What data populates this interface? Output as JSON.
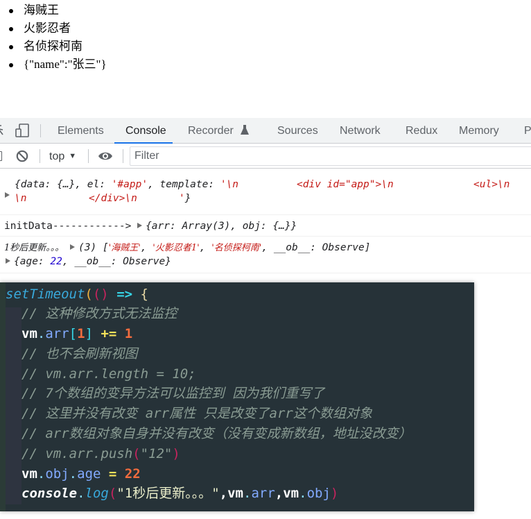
{
  "page": {
    "list_items": [
      "海贼王",
      "火影忍者",
      "名侦探柯南",
      "{\"name\":\"张三\"}"
    ]
  },
  "devtools": {
    "tabs": [
      "Elements",
      "Console",
      "Recorder",
      "Sources",
      "Network",
      "Redux",
      "Memory",
      "Pe"
    ],
    "active_tab": "Console",
    "recorder_icon": "flask-icon",
    "toolbar": {
      "context": "top",
      "filter_placeholder": "Filter"
    },
    "colors": {
      "accent": "#1a73e8",
      "string": "#c41a16",
      "number": "#1c00cf"
    }
  },
  "console": {
    "messages": [
      {
        "line1": {
          "open": "{data: {…}, el: ",
          "el_value": "'#app'",
          "template_key": ", template: ",
          "template_start": "'\\n",
          "div_open": "<div id=\"app\">\\n",
          "ul_open": "<ul>\\n"
        },
        "line2": {
          "nl": "\\n",
          "div_close": "</div>\\n",
          "end_quote": "'",
          "close": "}"
        }
      },
      {
        "label": "initData------------> ",
        "value": "{arr: Array(3), obj: {…}}"
      },
      {
        "label": "1秒后更新。。。",
        "array_prefix": "(3) [",
        "items": [
          "'海贼王'",
          "'火影忍者1'",
          "'名侦探柯南'"
        ],
        "sep": ", ",
        "observer": "__ob__: Observe]",
        "obj_open": "{age: ",
        "obj_age": "22",
        "obj_rest": ", __ob__: Observe}"
      }
    ]
  },
  "code": {
    "lines": [
      "setTimeout(() => {",
      "// 这种修改方式无法监控",
      "vm.arr[1] += 1",
      "// 也不会刷新视图",
      "// vm.arr.length = 10;",
      "// 7个数组的变异方法可以监控到 因为我们重写了",
      "// 这里并没有改变 arr属性 只是改变了arr这个数组对象",
      "// arr数组对象自身并没有改变（没有变成新数组，地址没改变）",
      "// vm.arr.push(\"12\")",
      "vm.obj.age = 22",
      "console.log(\"1秒后更新。。。\",vm.arr,vm.obj)"
    ],
    "tokens": {
      "set_timeout": "setTimeout",
      "paren_open": "(",
      "paren_close": ")",
      "arrow": " => ",
      "brace": "{",
      "vm": "vm",
      "dot": ".",
      "arr": "arr",
      "obj": "obj",
      "age": "age",
      "bracket_open": "[",
      "bracket_close": "]",
      "one": "1",
      "plus_eq": " += ",
      "eq": " = ",
      "twenty_two": "22",
      "console": "console",
      "log": "log",
      "log_string": "\"1秒后更新。。。\"",
      "comma": ",",
      "push_comment_prefix": "// vm.arr.push",
      "push_arg": "\"12\""
    }
  }
}
